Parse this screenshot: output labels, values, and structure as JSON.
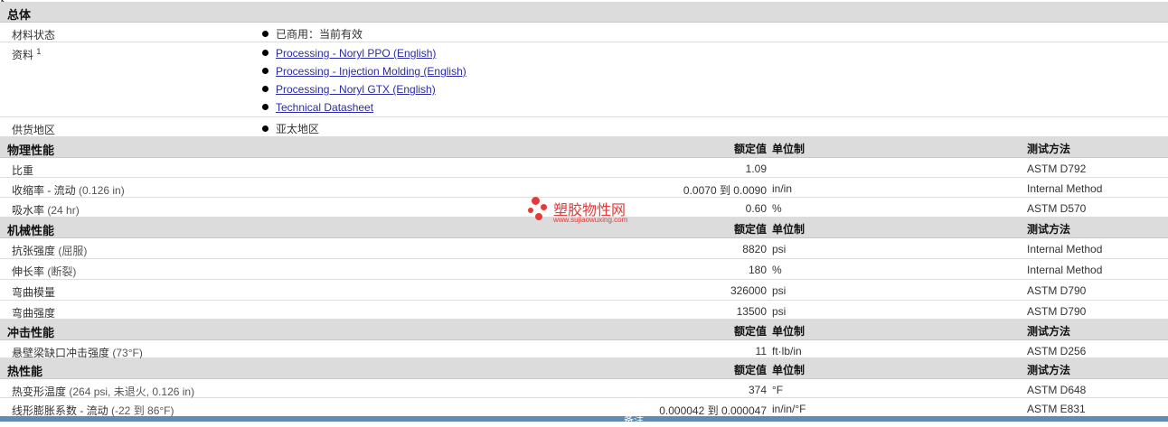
{
  "overview": {
    "title": "总体",
    "status_label": "材料状态",
    "status_value": "已商用：当前有效",
    "docs_label": "资料",
    "docs_sup": "1",
    "docs": [
      "Processing - Noryl PPO (English)",
      "Processing - Injection Molding (English)",
      "Processing - Noryl GTX (English)",
      "Technical Datasheet"
    ],
    "region_label": "供货地区",
    "region_value": "亚太地区"
  },
  "headers": {
    "value": "额定值",
    "unit": "单位制",
    "test": "测试方法"
  },
  "physical": {
    "title": "物理性能",
    "rows": [
      {
        "label": "比重",
        "cond": "",
        "value": "1.09",
        "unit": "",
        "test": "ASTM D792"
      },
      {
        "label": "收缩率 - 流动",
        "cond": "(0.126 in)",
        "value": "0.0070 到  0.0090",
        "unit": "in/in",
        "test": "Internal Method"
      },
      {
        "label": "吸水率",
        "cond": "(24 hr)",
        "value": "0.60",
        "unit": "%",
        "test": "ASTM D570"
      }
    ]
  },
  "mechanical": {
    "title": "机械性能",
    "rows": [
      {
        "label": "抗张强度",
        "cond": "(屈服)",
        "value": "8820",
        "unit": "psi",
        "test": "Internal Method"
      },
      {
        "label": "伸长率",
        "cond": "(断裂)",
        "value": "180",
        "unit": "%",
        "test": "Internal Method"
      },
      {
        "label": "弯曲模量",
        "cond": "",
        "value": "326000",
        "unit": "psi",
        "test": "ASTM D790"
      },
      {
        "label": "弯曲强度",
        "cond": "",
        "value": "13500",
        "unit": "psi",
        "test": "ASTM D790"
      }
    ]
  },
  "impact": {
    "title": "冲击性能",
    "rows": [
      {
        "label": "悬壁梁缺口冲击强度",
        "cond": "(73°F)",
        "value": "11",
        "unit": "ft·lb/in",
        "test": "ASTM D256"
      }
    ]
  },
  "thermal": {
    "title": "热性能",
    "rows": [
      {
        "label": "热变形温度",
        "cond": "(264 psi, 未退火, 0.126 in)",
        "value": "374",
        "unit": "°F",
        "test": "ASTM D648"
      },
      {
        "label": "线形膨胀系数 - 流动",
        "cond": "(-22 到  86°F)",
        "value": "0.000042 到  0.000047",
        "unit": "in/in/°F",
        "test": "ASTM E831"
      }
    ]
  },
  "watermark": {
    "text": "塑胶物性网",
    "url": "www.sujiaowuxing.com",
    "color": "#e23a3a"
  },
  "footer": {
    "label": "备注"
  }
}
